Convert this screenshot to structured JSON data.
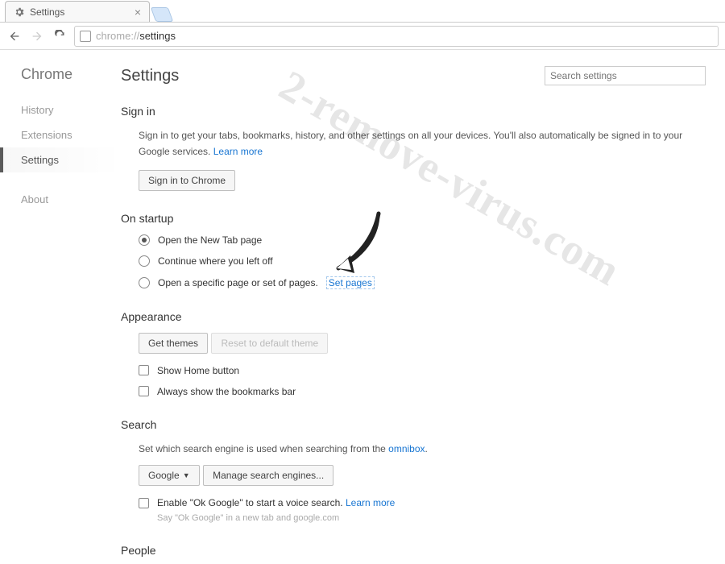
{
  "browser": {
    "tab_title": "Settings",
    "url_gray": "chrome://",
    "url_rest": "settings"
  },
  "sidebar": {
    "brand": "Chrome",
    "items": [
      {
        "label": "History"
      },
      {
        "label": "Extensions"
      },
      {
        "label": "Settings"
      },
      {
        "label": "About"
      }
    ]
  },
  "header": {
    "title": "Settings",
    "search_placeholder": "Search settings"
  },
  "signin": {
    "heading": "Sign in",
    "body1": "Sign in to get your tabs, bookmarks, history, and other settings on all your devices. You'll also automatically be signed in to your Google services. ",
    "learn": "Learn more",
    "button": "Sign in to Chrome"
  },
  "startup": {
    "heading": "On startup",
    "opt1": "Open the New Tab page",
    "opt2": "Continue where you left off",
    "opt3": "Open a specific page or set of pages.",
    "set_pages": "Set pages"
  },
  "appearance": {
    "heading": "Appearance",
    "get_themes": "Get themes",
    "reset_theme": "Reset to default theme",
    "home_button": "Show Home button",
    "bookmarks_bar": "Always show the bookmarks bar"
  },
  "search": {
    "heading": "Search",
    "body": "Set which search engine is used when searching from the ",
    "omnibox": "omnibox",
    "engine": "Google",
    "manage": "Manage search engines...",
    "ok_google": "Enable \"Ok Google\" to start a voice search. ",
    "learn": "Learn more",
    "hint": "Say \"Ok Google\" in a new tab and google.com"
  },
  "people": {
    "heading": "People"
  },
  "watermark": "2-remove-virus.com"
}
